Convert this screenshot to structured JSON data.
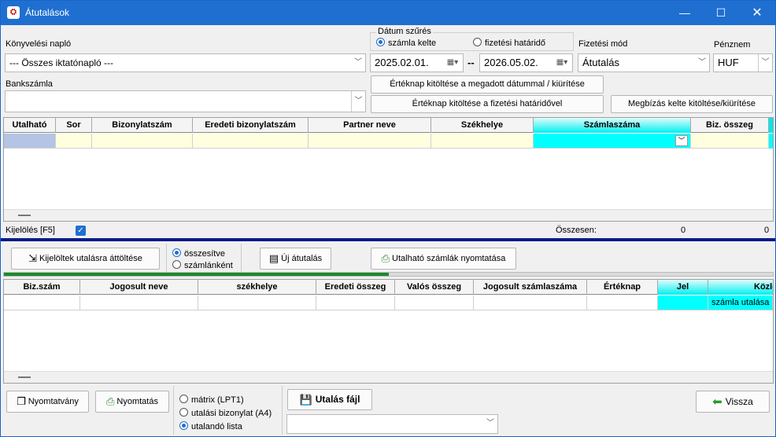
{
  "window": {
    "title": "Átutalások"
  },
  "filters": {
    "konyvelesi_naplo_label": "Könyvelési napló",
    "konyvelesi_naplo_value": "--- Összes iktatónapló ---",
    "datum_szures_label": "Dátum szűrés",
    "radio_szamla_kelte": "számla kelte",
    "radio_fizetesi_hatarido": "fizetési határidő",
    "date_from": "2025.02.01.",
    "date_sep": "--",
    "date_to": "2026.05.02.",
    "fizetesi_mod_label": "Fizetési mód",
    "fizetesi_mod_value": "Átutalás",
    "penznem_label": "Pénznem",
    "penznem_value": "HUF",
    "bankszamla_label": "Bankszámla",
    "bankszamla_value": ""
  },
  "buttons": {
    "erteknap_datummal": "Értéknap kitöltése a megadott dátummal / kiürítése",
    "erteknap_hatarido": "Értéknap kitöltése a fizetési határidővel",
    "megbizas_kelte": "Megbízás kelte kitöltése/kiürítése",
    "kijeloltek_attoltese": "Kijelöltek utalásra áttöltése",
    "uj_atutalas": "Új átutalás",
    "utalhato_nyomtatas": "Utalható számlák nyomtatása",
    "nyomtatvany": "Nyomtatvány",
    "nyomtatas": "Nyomtatás",
    "utalas_fajl": "Utalás fájl",
    "vissza": "Vissza"
  },
  "top_grid": {
    "columns": [
      "Utalható",
      "Sor",
      "Bizonylatszám",
      "Eredeti bizonylatszám",
      "Partner neve",
      "Székhelye",
      "Számlaszáma",
      "Biz. összeg"
    ]
  },
  "selection_bar": {
    "kijeloles_label": "Kijelölés [F5]",
    "osszesen_label": "Összesen:",
    "osszesen_count": "0",
    "osszesen_amount": "0"
  },
  "group_mode": {
    "osszesitve": "összesítve",
    "szamlankent": "számlánként"
  },
  "progress": {
    "value": 0.5
  },
  "bottom_grid": {
    "columns": [
      "Biz.szám",
      "Jogosult neve",
      "székhelye",
      "Eredeti összeg",
      "Valós összeg",
      "Jogosult számlaszáma",
      "Értéknap",
      "Jel",
      "Közle"
    ],
    "row_kozlemeny": "számla utalása"
  },
  "print_mode": {
    "matrix": "mátrix (LPT1)",
    "utalasi_bizonylat": "utalási bizonylat (A4)",
    "utalando_lista": "utalandó lista"
  },
  "utalas_fajl_combo_value": "",
  "colors": {
    "accent": "#1f6fd1",
    "cyan": "#00ffff",
    "yellow_row": "#ffffe0",
    "progress": "#1a8a2a"
  }
}
